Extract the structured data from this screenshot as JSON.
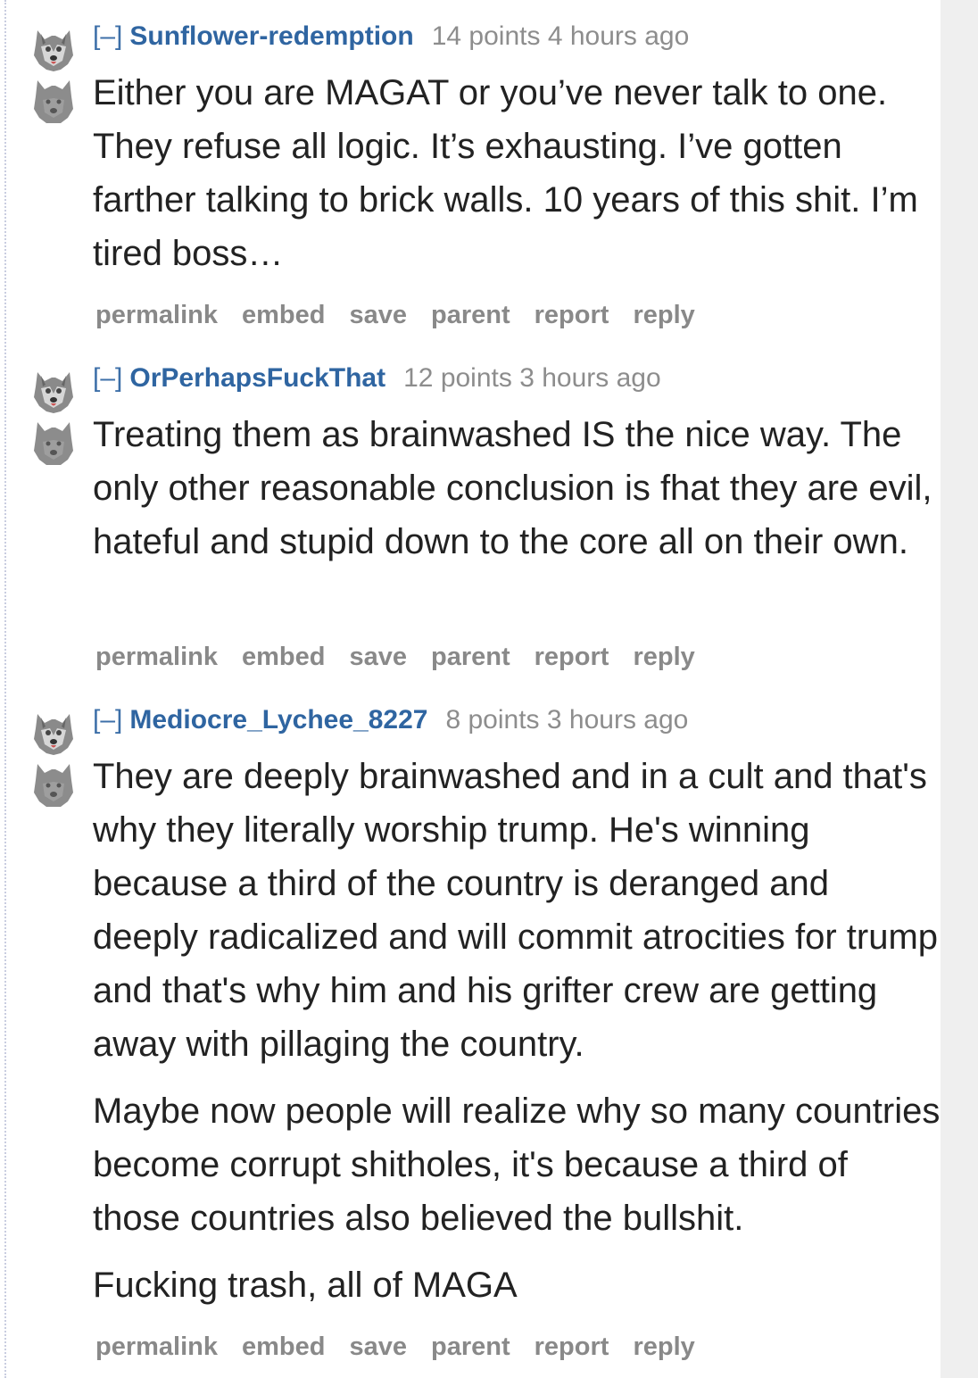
{
  "collapse_label": "[–]",
  "comments": [
    {
      "author": "Sunflower-redemption",
      "points": "14 points",
      "time": "4 hours ago",
      "paragraphs": [
        "Either you are MAGAT or you’ve never talk to one. They refuse all logic. It’s exhausting. I’ve gotten farther talking to brick walls. 10 years of this shit. I’m tired boss…"
      ]
    },
    {
      "author": "OrPerhapsFuckThat",
      "points": "12 points",
      "time": "3 hours ago",
      "paragraphs": [
        "Treating them as brainwashed IS the nice way. The only other reasonable conclusion is fhat they are evil, hateful and stupid down to the core all on their own."
      ]
    },
    {
      "author": "Mediocre_Lychee_8227",
      "points": "8 points",
      "time": "3 hours ago",
      "paragraphs": [
        "They are deeply brainwashed and in a cult and that's why they literally worship trump. He's winning because a third of the country is deranged and deeply radicalized and will commit atrocities for trump and that's why him and his grifter crew are getting away with pillaging the country.",
        "Maybe now people will realize why so many countries become corrupt shitholes, it's because a third of those countries also believed the bullshit.",
        "Fucking trash, all of MAGA"
      ]
    }
  ],
  "actions": {
    "permalink": "permalink",
    "embed": "embed",
    "save": "save",
    "parent": "parent",
    "report": "report",
    "reply": "reply"
  },
  "colors": {
    "author": "#2f65a1",
    "meta": "#8d8d8d",
    "body": "#222222",
    "buttons": "#898989",
    "scrollbar": "#efefef"
  },
  "icons": {
    "upvote": "wolf-upvote-icon",
    "downvote": "wolf-downvote-icon"
  }
}
